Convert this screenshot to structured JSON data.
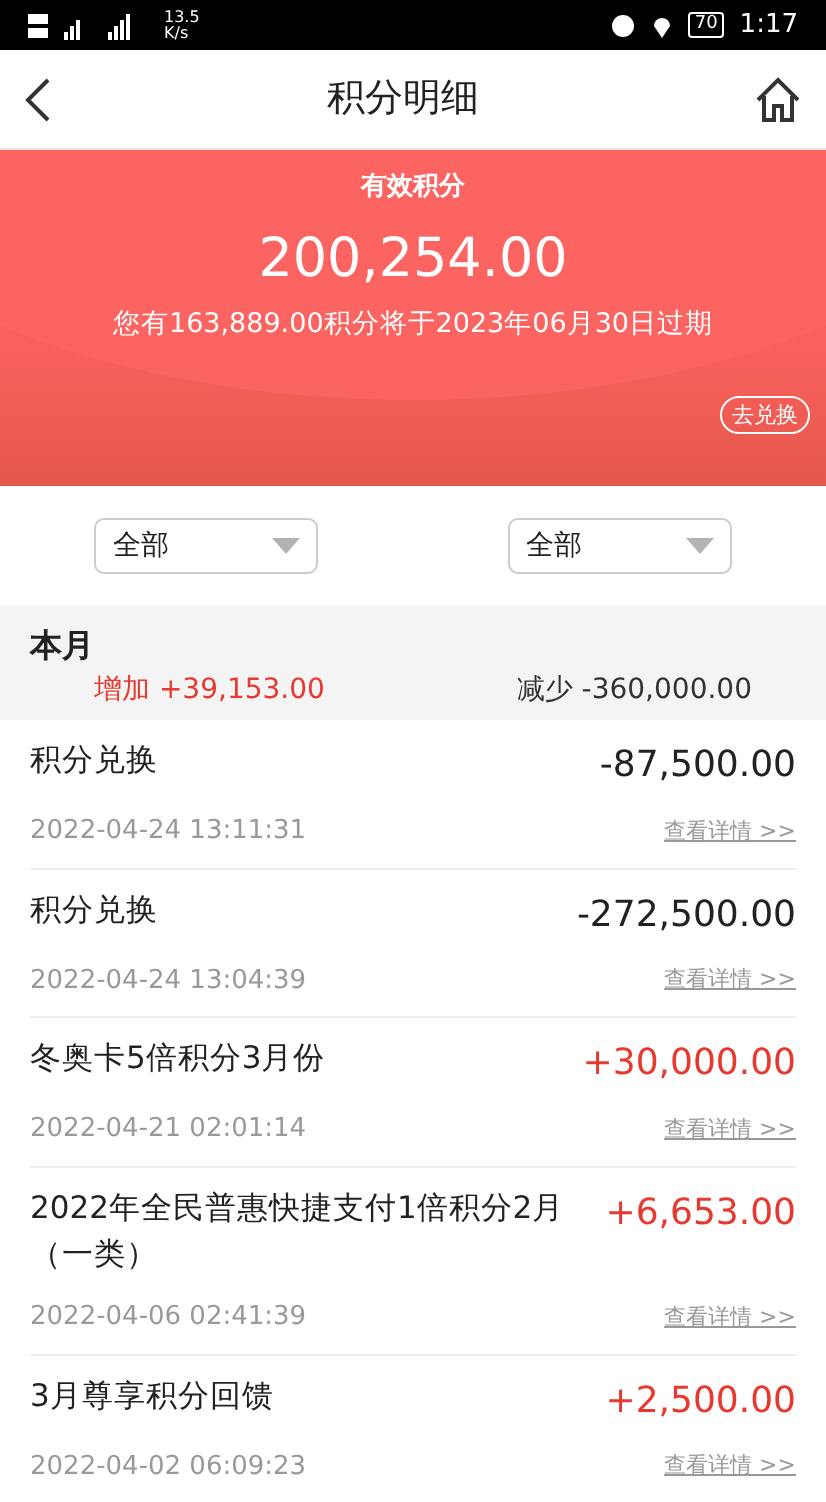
{
  "status_bar": {
    "network_speed": "13.5\nK/s",
    "battery": "70",
    "time": "1:17"
  },
  "header": {
    "title": "积分明细"
  },
  "summary": {
    "label": "有效积分",
    "points": "200,254.00",
    "expiry_note": "您有163,889.00积分将于2023年06月30日过期",
    "redeem_button": "去兑换"
  },
  "filters": [
    {
      "value": "全部"
    },
    {
      "value": "全部"
    }
  ],
  "month": {
    "title": "本月",
    "increase": "增加 +39,153.00",
    "decrease": "减少 -360,000.00"
  },
  "transactions": [
    {
      "title": "积分兑换",
      "amount": "-87,500.00",
      "kind": "debit",
      "time": "2022-04-24 13:11:31",
      "details": "查看详情 >>"
    },
    {
      "title": "积分兑换",
      "amount": "-272,500.00",
      "kind": "debit",
      "time": "2022-04-24 13:04:39",
      "details": "查看详情 >>"
    },
    {
      "title": "冬奥卡5倍积分3月份",
      "amount": "+30,000.00",
      "kind": "credit",
      "time": "2022-04-21 02:01:14",
      "details": "查看详情 >>"
    },
    {
      "title": "2022年全民普惠快捷支付1倍积分2月（一类）",
      "amount": "+6,653.00",
      "kind": "credit",
      "time": "2022-04-06 02:41:39",
      "details": "查看详情 >>"
    },
    {
      "title": "3月尊享积分回馈",
      "amount": "+2,500.00",
      "kind": "credit",
      "time": "2022-04-02 06:09:23",
      "details": "查看详情 >>"
    }
  ]
}
